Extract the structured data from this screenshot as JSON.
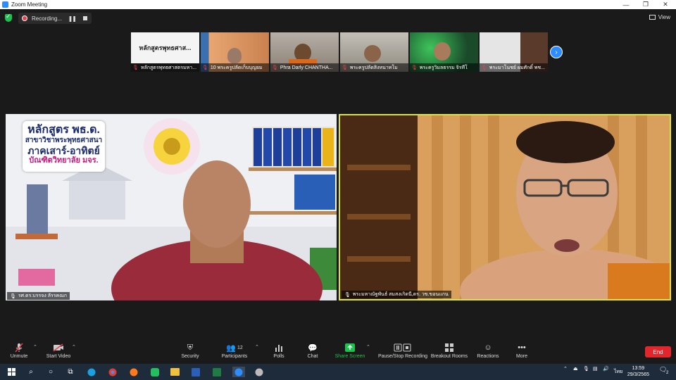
{
  "window": {
    "title": "Zoom Meeting",
    "controls": [
      "—",
      "❐",
      "✕"
    ]
  },
  "status": {
    "recording_label": "Recording...",
    "view_label": "View"
  },
  "thumbnails": [
    {
      "name": "หลักสูตรพุทธศาสตรมหา...",
      "card_text": "หลักสูตรพุทธศาส..."
    },
    {
      "name": "10 พระครูปลัดเก็บบุญยม"
    },
    {
      "name": "Phra Darly CHANTHA..."
    },
    {
      "name": "พระครูปลัดสิงหนาทโม"
    },
    {
      "name": "พระครูวิมลธรรม จิรทีโ"
    },
    {
      "name": "พระมาโนชย์ ผมศักดิ์ พช..."
    }
  ],
  "left_panel": {
    "caption": "รศ.ดร.บรรจง ลัรรคณก",
    "course": {
      "line1": "หลักสูตร พธ.ด.",
      "line2": "สาขาวิชาพระพุทธศาสนา",
      "line3": "ภาคเสาร์-อาทิตย์",
      "line4": "บัณฑิตวิทยาลัย มจร."
    }
  },
  "right_panel": {
    "caption": "พระมหาณัฐพันธ์ สมสงเกิดนี,ดร. วข.ขอนแกน"
  },
  "toolbar": {
    "unmute": "Unmute",
    "start_video": "Start Video",
    "security": "Security",
    "participants": "Participants",
    "participants_count": "12",
    "polls": "Polls",
    "chat": "Chat",
    "share_screen": "Share Screen",
    "pause_recording": "Pause/Stop Recording",
    "breakout_rooms": "Breakout Rooms",
    "reactions": "Reactions",
    "more": "More",
    "end": "End"
  },
  "taskbar": {
    "lang": "ไทย",
    "time": "13:59",
    "date": "29/3/2565",
    "notif_count": "2"
  },
  "colors": {
    "accent_blue": "#2d8cff",
    "active_speaker_border": "#d6e34a",
    "end_red": "#e3262b",
    "share_green": "#1bc24d"
  }
}
